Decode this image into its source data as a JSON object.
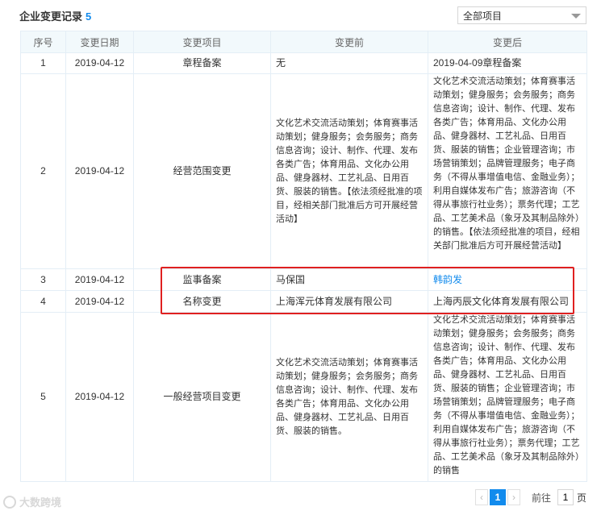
{
  "header": {
    "title": "企业变更记录",
    "count": "5"
  },
  "filter": {
    "selected": "全部项目"
  },
  "table": {
    "columns": [
      "序号",
      "变更日期",
      "变更项目",
      "变更前",
      "变更后"
    ],
    "rows": [
      {
        "no": "1",
        "date": "2019-04-12",
        "item": "章程备案",
        "before": "无",
        "after": "2019-04-09章程备案"
      },
      {
        "no": "2",
        "date": "2019-04-12",
        "item": "经营范围变更",
        "before": "文化艺术交流活动策划；体育赛事活动策划；健身服务；会务服务；商务信息咨询；设计、制作、代理、发布各类广告；体育用品、文化办公用品、健身器材、工艺礼品、日用百货、服装的销售。【依法须经批准的项目，经相关部门批准后方可开展经营活动】",
        "after": "文化艺术交流活动策划；体育赛事活动策划；健身服务；会务服务；商务信息咨询；设计、制作、代理、发布各类广告；体育用品、文化办公用品、健身器材、工艺礼品、日用百货、服装的销售；企业管理咨询；市场营销策划；品牌管理服务；电子商务（不得从事增值电信、金融业务）；利用自媒体发布广告；旅游咨询（不得从事旅行社业务）；票务代理；工艺品、工艺美术品（象牙及其制品除外）的销售。【依法须经批准的项目，经相关部门批准后方可开展经营活动】"
      },
      {
        "no": "3",
        "date": "2019-04-12",
        "item": "监事备案",
        "before": "马保国",
        "after": "韩韵发"
      },
      {
        "no": "4",
        "date": "2019-04-12",
        "item": "名称变更",
        "before": "上海浑元体育发展有限公司",
        "after": "上海丙辰文化体育发展有限公司"
      },
      {
        "no": "5",
        "date": "2019-04-12",
        "item": "一般经营项目变更",
        "before": "文化艺术交流活动策划；体育赛事活动策划；健身服务；会务服务；商务信息咨询；设计、制作、代理、发布各类广告；体育用品、文化办公用品、健身器材、工艺礼品、日用百货、服装的销售。",
        "after": "文化艺术交流活动策划；体育赛事活动策划；健身服务；会务服务；商务信息咨询；设计、制作、代理、发布各类广告；体育用品、文化办公用品、健身器材、工艺礼品、日用百货、服装的销售；企业管理咨询；市场营销策划；品牌管理服务；电子商务（不得从事增值电信、金融业务）；利用自媒体发布广告；旅游咨询（不得从事旅行社业务）；票务代理；工艺品、工艺美术品（象牙及其制品除外）的销售"
      }
    ]
  },
  "pagination": {
    "prev": "‹",
    "current": "1",
    "next": "›",
    "goto_label": "前往",
    "goto_value": "1",
    "page_unit": "页"
  },
  "watermark": {
    "text": "大数跨境"
  },
  "colors": {
    "accent": "#128bed",
    "highlight_border": "#e02020",
    "header_bg": "#f2f9fc"
  }
}
